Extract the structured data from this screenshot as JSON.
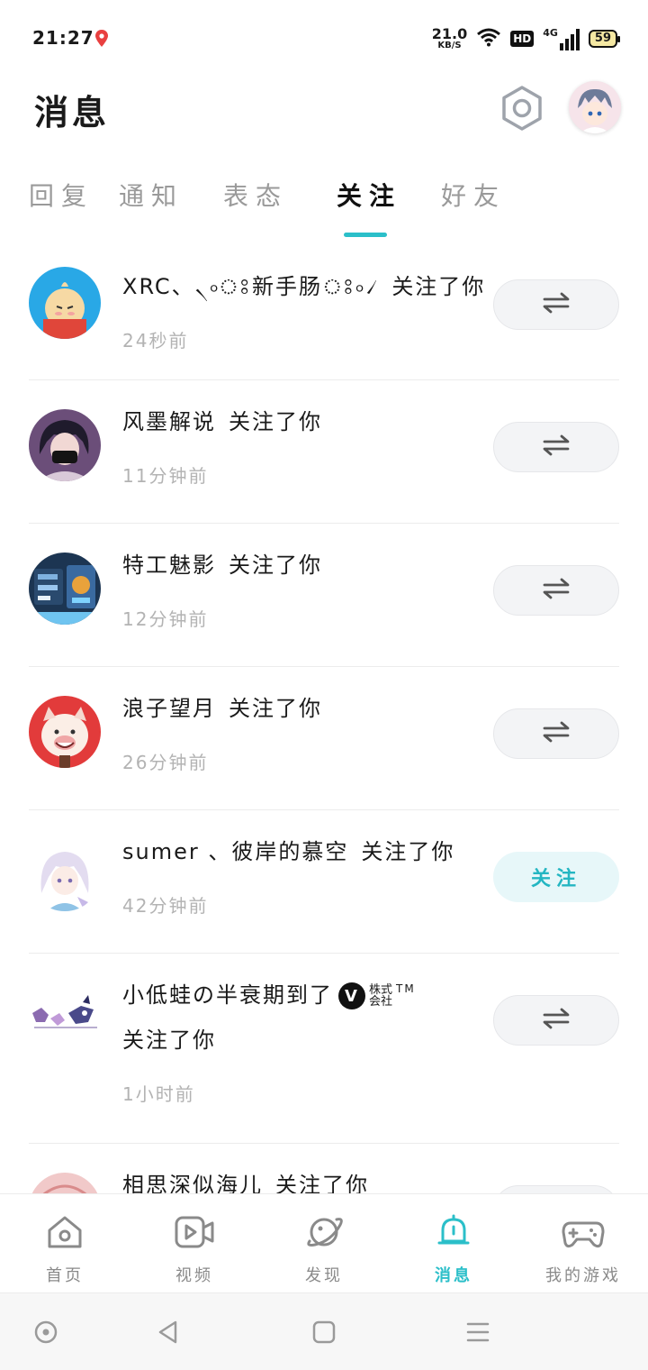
{
  "status_bar": {
    "time": "21:27",
    "net_speed_value": "21.0",
    "net_speed_unit": "KB/S",
    "hd_label": "HD",
    "network_label": "4G",
    "battery": "59"
  },
  "header": {
    "title": "消息"
  },
  "tabs": [
    {
      "label": "回复"
    },
    {
      "label": "通知"
    },
    {
      "label": "表态"
    },
    {
      "label": "关注"
    },
    {
      "label": "好友"
    }
  ],
  "active_tab": "关注",
  "accent_color": "#2bbfc9",
  "followed_suffix": "关注了你",
  "follow_label": "关注",
  "follows": [
    {
      "name": "XRC、৲৹ঃ新手肠ঃ৹৴",
      "time": "24秒前",
      "action": "mutual"
    },
    {
      "name": "风墨解说",
      "time": "11分钟前",
      "action": "mutual"
    },
    {
      "name": "特工魅影",
      "time": "12分钟前",
      "action": "mutual"
    },
    {
      "name": "浪子望月",
      "time": "26分钟前",
      "action": "mutual"
    },
    {
      "name": "sumer 、彼岸的慕空",
      "time": "42分钟前",
      "action": "follow"
    },
    {
      "name": "小低蛙の半衰期到了",
      "brand_badge": "V",
      "brand_text_1": "株式",
      "brand_text_2": "会社",
      "brand_tm": "TM",
      "time": "1小时前",
      "action": "mutual"
    },
    {
      "name": "相思深似海儿",
      "time": "",
      "action": "mutual"
    }
  ],
  "bottom_nav": [
    {
      "label": "首页",
      "icon": "home-icon"
    },
    {
      "label": "视频",
      "icon": "video-icon"
    },
    {
      "label": "发现",
      "icon": "planet-icon"
    },
    {
      "label": "消息",
      "icon": "bell-icon",
      "active": true
    },
    {
      "label": "我的游戏",
      "icon": "gamepad-icon"
    }
  ]
}
